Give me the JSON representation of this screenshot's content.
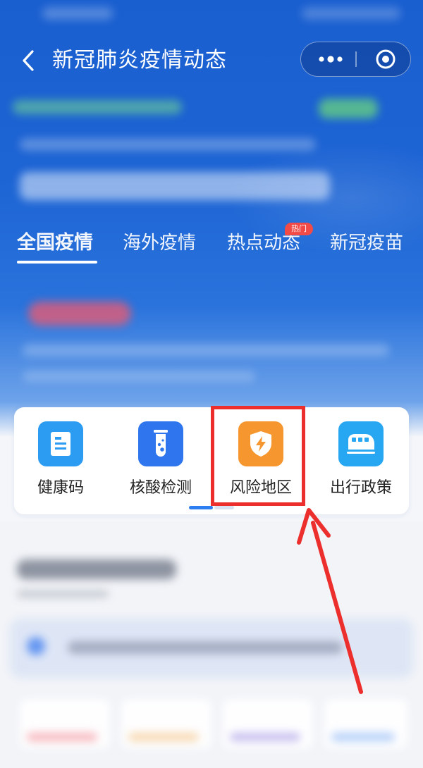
{
  "header": {
    "title": "新冠肺炎疫情动态",
    "back_icon": "chevron-left-icon",
    "more_icon": "more-dots-icon",
    "close_icon": "target-circle-icon"
  },
  "tabs": [
    {
      "label": "全国疫情",
      "active": true
    },
    {
      "label": "海外疫情",
      "active": false
    },
    {
      "label": "热点动态",
      "active": false,
      "badge": "热门"
    },
    {
      "label": "新冠疫苗",
      "active": false
    }
  ],
  "services": [
    {
      "label": "健康码",
      "icon": "document-icon",
      "color": "#2b9cf2"
    },
    {
      "label": "核酸检测",
      "icon": "test-tube-icon",
      "color": "#2f76ee"
    },
    {
      "label": "风险地区",
      "icon": "lightning-shield-icon",
      "color": "#f6962e"
    },
    {
      "label": "出行政策",
      "icon": "train-icon",
      "color": "#27a6f2"
    }
  ],
  "pager": {
    "pages": 2,
    "current": 1
  },
  "colors": {
    "header_blue": "#1d64d4",
    "highlight_red": "#ec2f2c",
    "badge_red": "#f24a46"
  }
}
